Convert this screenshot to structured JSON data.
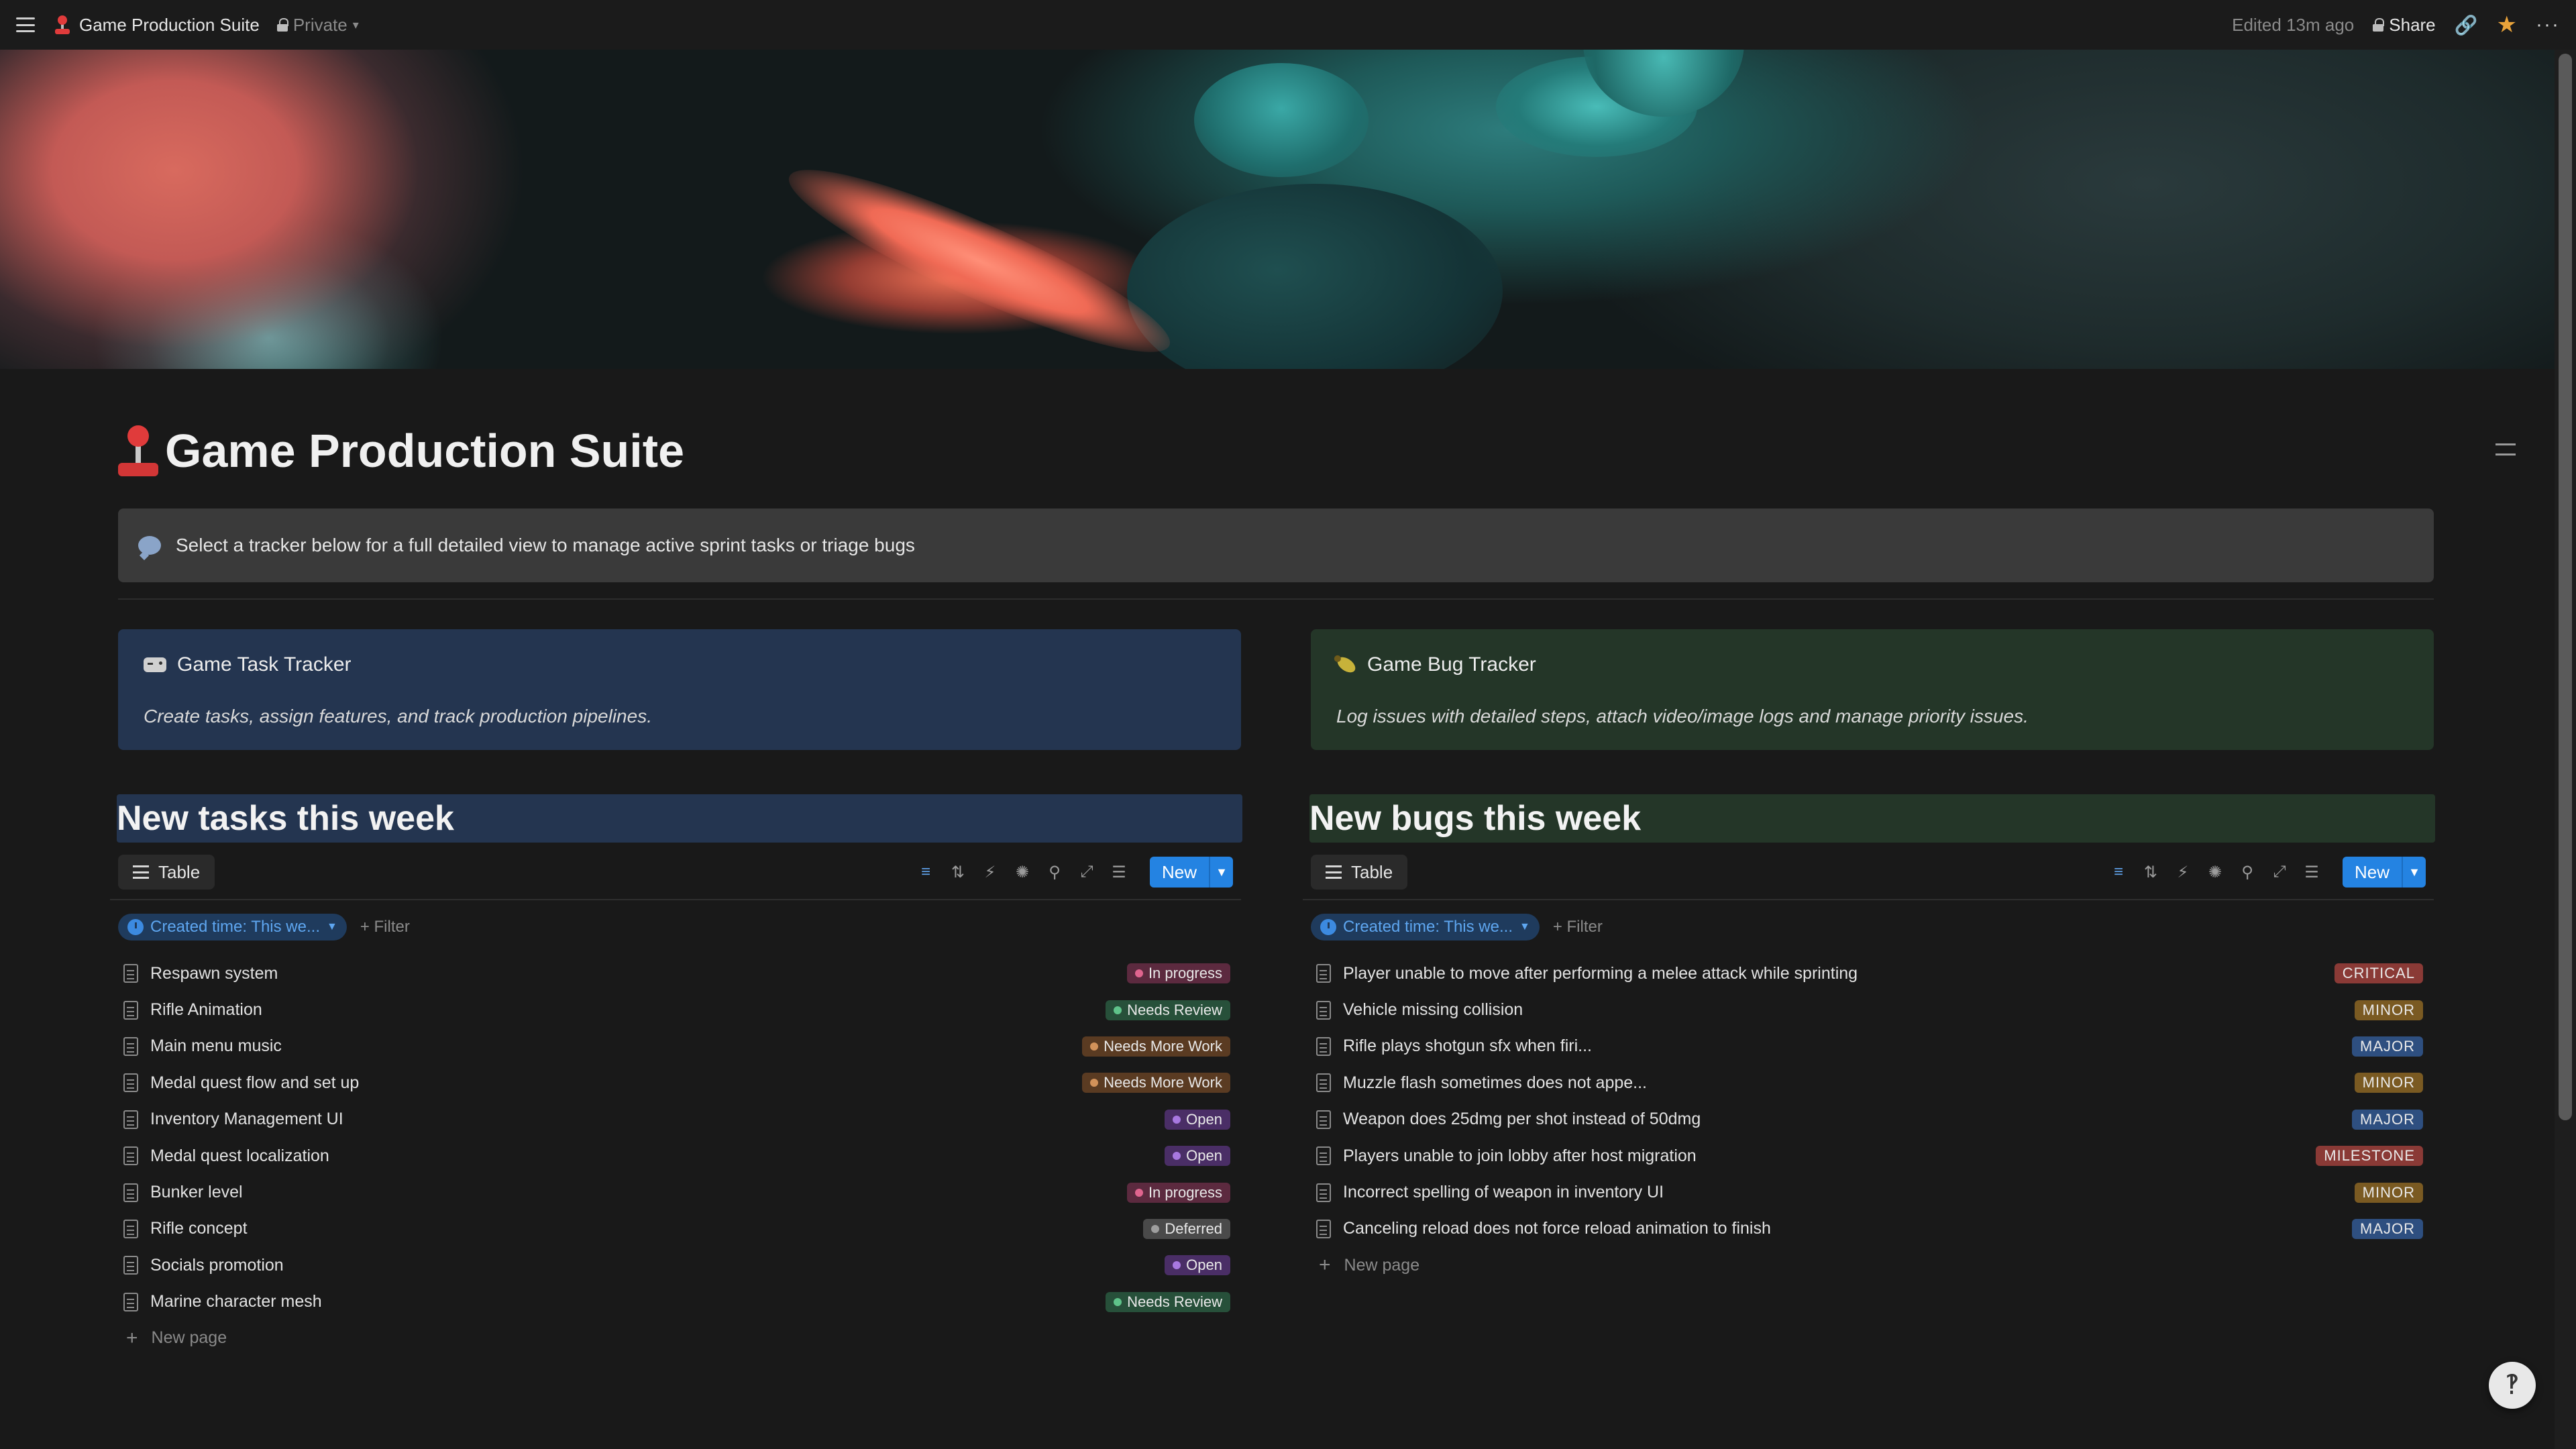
{
  "topbar": {
    "page_name": "Game Production Suite",
    "privacy": "Private",
    "edited": "Edited 13m ago",
    "share": "Share"
  },
  "page": {
    "title": "Game Production Suite",
    "callout": "Select a tracker below for a full detailed view to manage active sprint tasks or triage bugs"
  },
  "cards": {
    "tasks": {
      "title": "Game Task Tracker",
      "desc": "Create tasks, assign features, and track production pipelines."
    },
    "bugs": {
      "title": "Game Bug Tracker",
      "desc": "Log issues with detailed steps, attach video/image logs and manage priority issues."
    }
  },
  "tasks_section": {
    "heading": "New tasks this week",
    "view_tab": "Table",
    "new_button": "New",
    "filter_chip": "Created time: This we...",
    "add_filter": "+ Filter",
    "new_page": "New page",
    "rows": [
      {
        "name": "Respawn system",
        "status": "In progress",
        "bg": "#5c2a3f",
        "dot": "#e0658f"
      },
      {
        "name": "Rifle Animation",
        "status": "Needs Review",
        "bg": "#27503a",
        "dot": "#5fc38a"
      },
      {
        "name": "Main menu music",
        "status": "Needs More Work",
        "bg": "#5a3b22",
        "dot": "#d2925a"
      },
      {
        "name": "Medal quest flow and set up",
        "status": "Needs More Work",
        "bg": "#5a3b22",
        "dot": "#d2925a"
      },
      {
        "name": "Inventory Management UI",
        "status": "Open",
        "bg": "#4a2e66",
        "dot": "#a878e0"
      },
      {
        "name": "Medal quest localization",
        "status": "Open",
        "bg": "#4a2e66",
        "dot": "#a878e0"
      },
      {
        "name": "Bunker level",
        "status": "In progress",
        "bg": "#5c2a3f",
        "dot": "#e0658f"
      },
      {
        "name": "Rifle concept",
        "status": "Deferred",
        "bg": "#4a4a4a",
        "dot": "#9e9e9e"
      },
      {
        "name": "Socials promotion",
        "status": "Open",
        "bg": "#4a2e66",
        "dot": "#a878e0"
      },
      {
        "name": "Marine character mesh",
        "status": "Needs Review",
        "bg": "#27503a",
        "dot": "#5fc38a"
      }
    ]
  },
  "bugs_section": {
    "heading": "New bugs this week",
    "view_tab": "Table",
    "new_button": "New",
    "filter_chip": "Created time: This we...",
    "add_filter": "+ Filter",
    "new_page": "New page",
    "rows": [
      {
        "name": "Player unable to move after performing a melee attack while sprinting",
        "priority": "CRITICAL",
        "bg": "#8a3a36"
      },
      {
        "name": "Vehicle missing collision",
        "priority": "MINOR",
        "bg": "#7a5a22"
      },
      {
        "name": "Rifle plays shotgun sfx when firi...",
        "priority": "MAJOR",
        "bg": "#2e4f80"
      },
      {
        "name": "Muzzle flash sometimes does not appe...",
        "priority": "MINOR",
        "bg": "#7a5a22"
      },
      {
        "name": "Weapon does 25dmg per shot instead of 50dmg",
        "priority": "MAJOR",
        "bg": "#2e4f80"
      },
      {
        "name": "Players unable to join lobby after host migration",
        "priority": "MILESTONE",
        "bg": "#8a3a36"
      },
      {
        "name": "Incorrect spelling of weapon in inventory UI",
        "priority": "MINOR",
        "bg": "#7a5a22"
      },
      {
        "name": "Canceling reload does not force reload animation to finish",
        "priority": "MAJOR",
        "bg": "#2e4f80"
      }
    ]
  },
  "icons": {
    "menu": "hamburger-icon",
    "page": "joystick-icon",
    "privacy": "lock-icon",
    "link": "link-icon",
    "favorite": "star-icon",
    "more": "more-icon",
    "toc": "table-of-contents-icon",
    "callout": "speech-bubble-icon",
    "task_card": "game-controller-icon",
    "bug_card": "bug-icon",
    "row": "page-icon",
    "help": "help-icon"
  },
  "colors": {
    "accent": "#2483e2",
    "favorite": "#e8a23a",
    "tasks_bg": "#243550",
    "bugs_bg": "#243628"
  }
}
